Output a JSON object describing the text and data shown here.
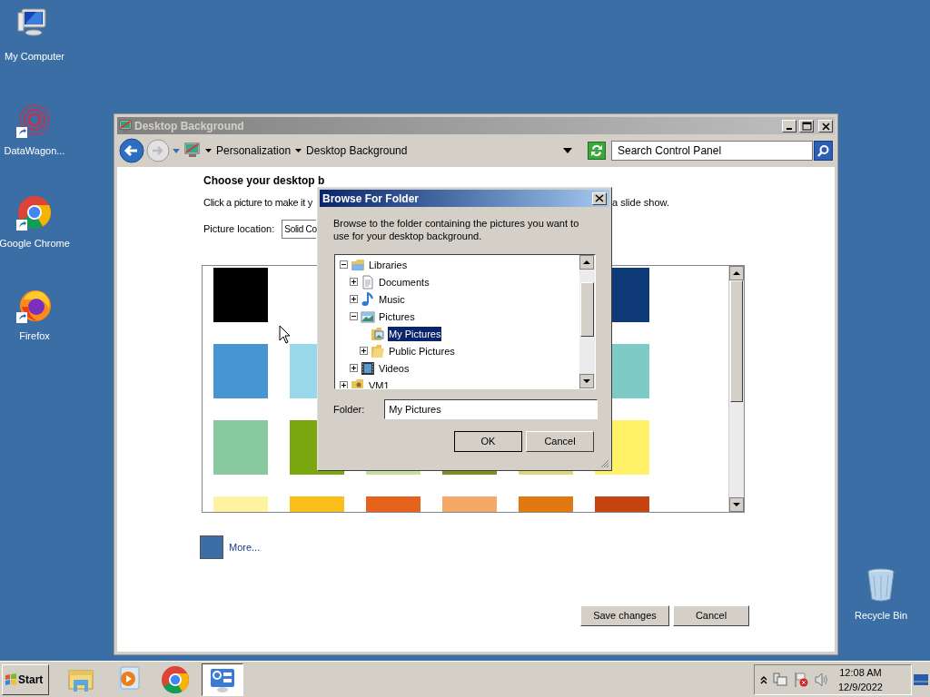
{
  "desktop_icons": [
    {
      "label": "My Computer",
      "kind": "computer"
    },
    {
      "label": "DataWagon...",
      "kind": "dots"
    },
    {
      "label": "Google Chrome",
      "kind": "browser"
    },
    {
      "label": "Firefox",
      "kind": "fox"
    },
    {
      "label": "Recycle Bin",
      "kind": "bin"
    }
  ],
  "window": {
    "title": "Desktop Background",
    "active": false,
    "breadcrumb": [
      "Personalization",
      "Desktop Background"
    ],
    "search": {
      "placeholder": "Search Control Panel"
    },
    "heading": "Choose your desktop b",
    "instruction_left": "Click a picture to make it y",
    "instruction_right": "a slide show.",
    "picture_location": {
      "label": "Picture location:",
      "value": "Solid Co"
    },
    "swatch_rows": [
      [
        {
          "color": "#000000"
        },
        null,
        null,
        null,
        null,
        {
          "color": "#0e3a78"
        }
      ],
      [
        {
          "color": "#4795d1"
        },
        {
          "color": "#99d8ea"
        },
        null,
        null,
        null,
        {
          "color": "#7ecac6"
        }
      ],
      [
        {
          "color": "#88c9a0"
        },
        {
          "color": "#7aa60e"
        },
        {
          "color": "#c6dea0"
        },
        {
          "color": "#838a1f"
        },
        {
          "color": "#dcd87a"
        },
        {
          "color": "#fff266"
        }
      ],
      [
        {
          "color": "#fef3a0"
        },
        {
          "color": "#fbbd1a"
        },
        {
          "color": "#e6631e"
        },
        {
          "color": "#f6a867"
        },
        {
          "color": "#e27812"
        },
        {
          "color": "#c54511"
        }
      ]
    ],
    "more": {
      "label": "More...",
      "color": "#3a6ea5"
    },
    "buttons": [
      "Save changes",
      "Cancel"
    ]
  },
  "dialog": {
    "title": "Browse For Folder",
    "description": "Browse to the folder containing the pictures you want to use for your desktop background.",
    "tree": [
      {
        "label": "Libraries",
        "kind": "library",
        "expanded": true,
        "selected": false,
        "children": [
          {
            "label": "Documents",
            "kind": "documents",
            "expanded": false,
            "selected": false
          },
          {
            "label": "Music",
            "kind": "music",
            "expanded": false,
            "selected": false
          },
          {
            "label": "Pictures",
            "kind": "pictures",
            "expanded": true,
            "selected": false,
            "children": [
              {
                "label": "My Pictures",
                "kind": "picfolder",
                "selected": true
              },
              {
                "label": "Public Pictures",
                "kind": "folder",
                "expanded": false,
                "selected": false
              }
            ]
          },
          {
            "label": "Videos",
            "kind": "videos",
            "expanded": false,
            "selected": false
          }
        ]
      },
      {
        "label": "VM1",
        "kind": "user",
        "expanded": false,
        "selected": false
      }
    ],
    "folder": {
      "label": "Folder:",
      "value": "My Pictures"
    },
    "buttons": [
      "OK",
      "Cancel"
    ]
  },
  "taskbar": {
    "start": "Start",
    "apps": [
      {
        "kind": "explorer",
        "active": false
      },
      {
        "kind": "media",
        "active": false
      },
      {
        "kind": "browser",
        "active": false
      },
      {
        "kind": "panel",
        "active": true
      }
    ],
    "time": "12:08 AM",
    "date": "12/9/2022"
  }
}
